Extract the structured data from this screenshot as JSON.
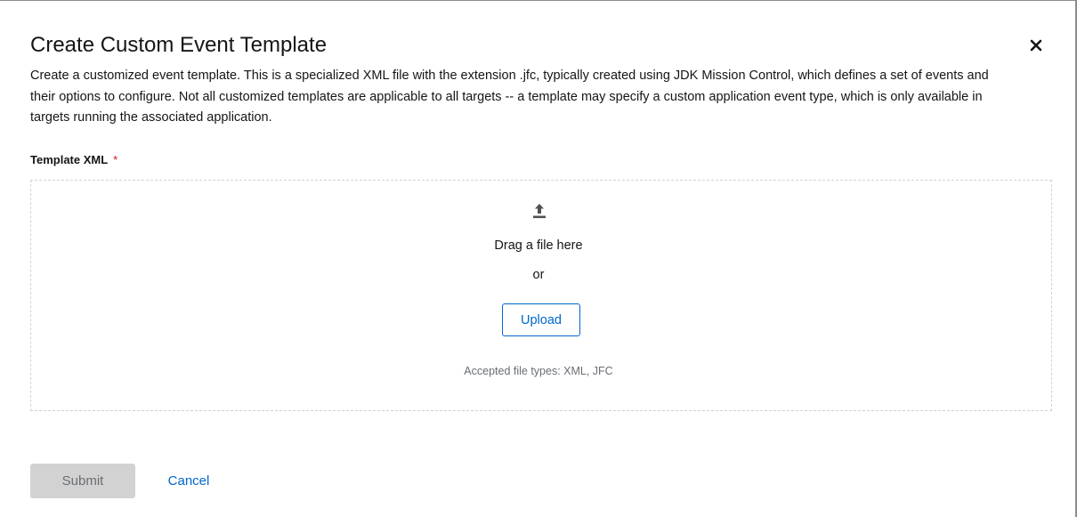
{
  "modal": {
    "title": "Create Custom Event Template",
    "close_icon": "close-icon",
    "description": "Create a customized event template. This is a specialized XML file with the extension .jfc, typically created using JDK Mission Control, which defines a set of events and their options to configure. Not all customized templates are applicable to all targets -- a template may specify a custom application event type, which is only available in targets running the associated application."
  },
  "form": {
    "field_label": "Template XML",
    "required_marker": "*",
    "dropzone": {
      "icon": "upload-icon",
      "drag_text": "Drag a file here",
      "or_text": "or",
      "upload_label": "Upload",
      "accepted_text": "Accepted file types: XML, JFC"
    }
  },
  "actions": {
    "submit_label": "Submit",
    "cancel_label": "Cancel"
  },
  "colors": {
    "primary_link": "#0066cc",
    "required": "#c9190b",
    "disabled_bg": "#d2d2d2",
    "muted_text": "#6a6e73"
  }
}
